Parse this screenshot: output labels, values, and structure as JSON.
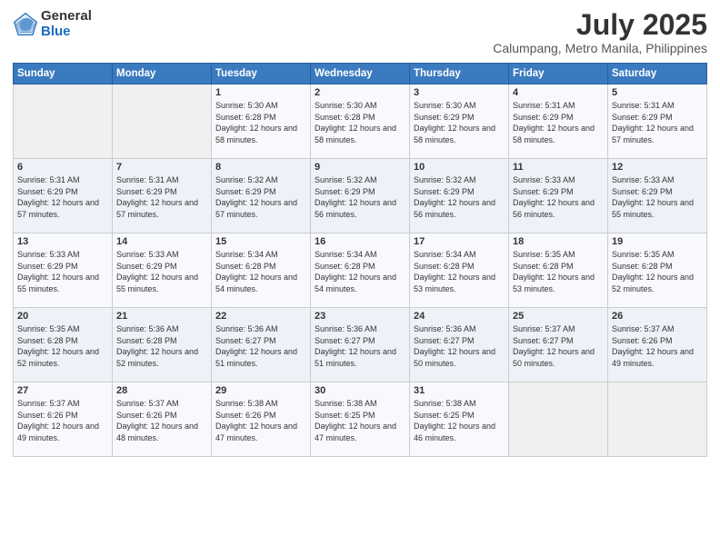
{
  "logo": {
    "general": "General",
    "blue": "Blue"
  },
  "title": {
    "month_year": "July 2025",
    "location": "Calumpang, Metro Manila, Philippines"
  },
  "days_of_week": [
    "Sunday",
    "Monday",
    "Tuesday",
    "Wednesday",
    "Thursday",
    "Friday",
    "Saturday"
  ],
  "weeks": [
    [
      {
        "day": "",
        "sunrise": "",
        "sunset": "",
        "daylight": ""
      },
      {
        "day": "",
        "sunrise": "",
        "sunset": "",
        "daylight": ""
      },
      {
        "day": "1",
        "sunrise": "Sunrise: 5:30 AM",
        "sunset": "Sunset: 6:28 PM",
        "daylight": "Daylight: 12 hours and 58 minutes."
      },
      {
        "day": "2",
        "sunrise": "Sunrise: 5:30 AM",
        "sunset": "Sunset: 6:28 PM",
        "daylight": "Daylight: 12 hours and 58 minutes."
      },
      {
        "day": "3",
        "sunrise": "Sunrise: 5:30 AM",
        "sunset": "Sunset: 6:29 PM",
        "daylight": "Daylight: 12 hours and 58 minutes."
      },
      {
        "day": "4",
        "sunrise": "Sunrise: 5:31 AM",
        "sunset": "Sunset: 6:29 PM",
        "daylight": "Daylight: 12 hours and 58 minutes."
      },
      {
        "day": "5",
        "sunrise": "Sunrise: 5:31 AM",
        "sunset": "Sunset: 6:29 PM",
        "daylight": "Daylight: 12 hours and 57 minutes."
      }
    ],
    [
      {
        "day": "6",
        "sunrise": "Sunrise: 5:31 AM",
        "sunset": "Sunset: 6:29 PM",
        "daylight": "Daylight: 12 hours and 57 minutes."
      },
      {
        "day": "7",
        "sunrise": "Sunrise: 5:31 AM",
        "sunset": "Sunset: 6:29 PM",
        "daylight": "Daylight: 12 hours and 57 minutes."
      },
      {
        "day": "8",
        "sunrise": "Sunrise: 5:32 AM",
        "sunset": "Sunset: 6:29 PM",
        "daylight": "Daylight: 12 hours and 57 minutes."
      },
      {
        "day": "9",
        "sunrise": "Sunrise: 5:32 AM",
        "sunset": "Sunset: 6:29 PM",
        "daylight": "Daylight: 12 hours and 56 minutes."
      },
      {
        "day": "10",
        "sunrise": "Sunrise: 5:32 AM",
        "sunset": "Sunset: 6:29 PM",
        "daylight": "Daylight: 12 hours and 56 minutes."
      },
      {
        "day": "11",
        "sunrise": "Sunrise: 5:33 AM",
        "sunset": "Sunset: 6:29 PM",
        "daylight": "Daylight: 12 hours and 56 minutes."
      },
      {
        "day": "12",
        "sunrise": "Sunrise: 5:33 AM",
        "sunset": "Sunset: 6:29 PM",
        "daylight": "Daylight: 12 hours and 55 minutes."
      }
    ],
    [
      {
        "day": "13",
        "sunrise": "Sunrise: 5:33 AM",
        "sunset": "Sunset: 6:29 PM",
        "daylight": "Daylight: 12 hours and 55 minutes."
      },
      {
        "day": "14",
        "sunrise": "Sunrise: 5:33 AM",
        "sunset": "Sunset: 6:29 PM",
        "daylight": "Daylight: 12 hours and 55 minutes."
      },
      {
        "day": "15",
        "sunrise": "Sunrise: 5:34 AM",
        "sunset": "Sunset: 6:28 PM",
        "daylight": "Daylight: 12 hours and 54 minutes."
      },
      {
        "day": "16",
        "sunrise": "Sunrise: 5:34 AM",
        "sunset": "Sunset: 6:28 PM",
        "daylight": "Daylight: 12 hours and 54 minutes."
      },
      {
        "day": "17",
        "sunrise": "Sunrise: 5:34 AM",
        "sunset": "Sunset: 6:28 PM",
        "daylight": "Daylight: 12 hours and 53 minutes."
      },
      {
        "day": "18",
        "sunrise": "Sunrise: 5:35 AM",
        "sunset": "Sunset: 6:28 PM",
        "daylight": "Daylight: 12 hours and 53 minutes."
      },
      {
        "day": "19",
        "sunrise": "Sunrise: 5:35 AM",
        "sunset": "Sunset: 6:28 PM",
        "daylight": "Daylight: 12 hours and 52 minutes."
      }
    ],
    [
      {
        "day": "20",
        "sunrise": "Sunrise: 5:35 AM",
        "sunset": "Sunset: 6:28 PM",
        "daylight": "Daylight: 12 hours and 52 minutes."
      },
      {
        "day": "21",
        "sunrise": "Sunrise: 5:36 AM",
        "sunset": "Sunset: 6:28 PM",
        "daylight": "Daylight: 12 hours and 52 minutes."
      },
      {
        "day": "22",
        "sunrise": "Sunrise: 5:36 AM",
        "sunset": "Sunset: 6:27 PM",
        "daylight": "Daylight: 12 hours and 51 minutes."
      },
      {
        "day": "23",
        "sunrise": "Sunrise: 5:36 AM",
        "sunset": "Sunset: 6:27 PM",
        "daylight": "Daylight: 12 hours and 51 minutes."
      },
      {
        "day": "24",
        "sunrise": "Sunrise: 5:36 AM",
        "sunset": "Sunset: 6:27 PM",
        "daylight": "Daylight: 12 hours and 50 minutes."
      },
      {
        "day": "25",
        "sunrise": "Sunrise: 5:37 AM",
        "sunset": "Sunset: 6:27 PM",
        "daylight": "Daylight: 12 hours and 50 minutes."
      },
      {
        "day": "26",
        "sunrise": "Sunrise: 5:37 AM",
        "sunset": "Sunset: 6:26 PM",
        "daylight": "Daylight: 12 hours and 49 minutes."
      }
    ],
    [
      {
        "day": "27",
        "sunrise": "Sunrise: 5:37 AM",
        "sunset": "Sunset: 6:26 PM",
        "daylight": "Daylight: 12 hours and 49 minutes."
      },
      {
        "day": "28",
        "sunrise": "Sunrise: 5:37 AM",
        "sunset": "Sunset: 6:26 PM",
        "daylight": "Daylight: 12 hours and 48 minutes."
      },
      {
        "day": "29",
        "sunrise": "Sunrise: 5:38 AM",
        "sunset": "Sunset: 6:26 PM",
        "daylight": "Daylight: 12 hours and 47 minutes."
      },
      {
        "day": "30",
        "sunrise": "Sunrise: 5:38 AM",
        "sunset": "Sunset: 6:25 PM",
        "daylight": "Daylight: 12 hours and 47 minutes."
      },
      {
        "day": "31",
        "sunrise": "Sunrise: 5:38 AM",
        "sunset": "Sunset: 6:25 PM",
        "daylight": "Daylight: 12 hours and 46 minutes."
      },
      {
        "day": "",
        "sunrise": "",
        "sunset": "",
        "daylight": ""
      },
      {
        "day": "",
        "sunrise": "",
        "sunset": "",
        "daylight": ""
      }
    ]
  ]
}
